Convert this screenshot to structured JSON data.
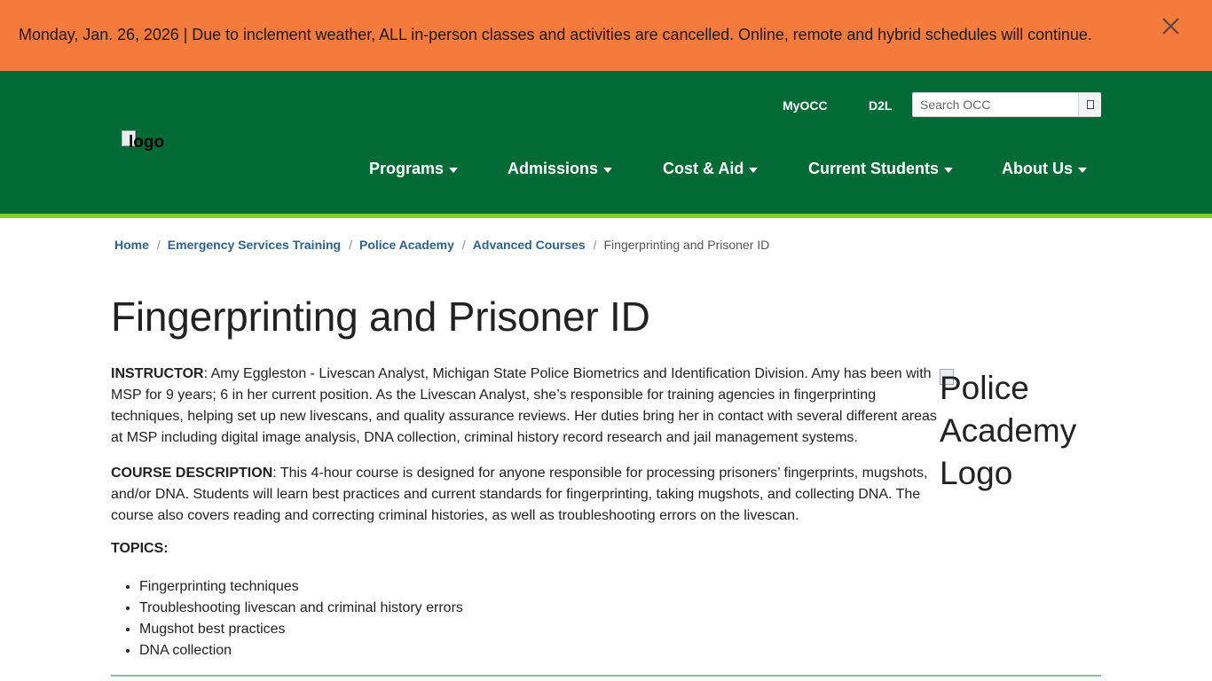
{
  "alert": {
    "message": "Monday, Jan. 26, 2026 | Due to inclement weather, ALL in-person classes and activities are cancelled. Online, remote and hybrid schedules will continue.",
    "close_icon": "close-icon"
  },
  "header": {
    "logo_alt": "logo",
    "utility_links": [
      "MyOCC",
      "D2L"
    ],
    "search": {
      "placeholder": "Search OCC",
      "button_icon": "search-icon"
    },
    "nav": [
      "Programs",
      "Admissions",
      "Cost & Aid",
      "Current Students",
      "About Us"
    ]
  },
  "breadcrumb": {
    "links": [
      "Home",
      "Emergency Services Training",
      "Police Academy",
      "Advanced Courses"
    ],
    "separator": "/",
    "current": "Fingerprinting and Prisoner ID"
  },
  "main": {
    "title": "Fingerprinting and Prisoner ID",
    "instructor_label": "INSTRUCTOR",
    "instructor_text": ": Amy Eggleston - Livescan Analyst, Michigan State Police Biometrics and Identification Division. Amy has been with MSP for 9 years; 6 in her current position.  As the Livescan Analyst, she’s responsible for training agencies in fingerprinting techniques, helping set up new livescans, and quality assurance reviews.  Her duties bring her in contact with several different areas at MSP including digital image analysis, DNA collection, criminal history record research and jail management systems.",
    "description_label": "COURSE DESCRIPTION",
    "description_text": ": This 4-hour course is designed for anyone responsible for processing prisoners’ fingerprints, mugshots, and/or DNA. Students will learn best practices and current standards for fingerprinting, taking mugshots, and collecting DNA. The course also covers reading and correcting criminal histories, as well as troubleshooting errors on the livescan.",
    "topics_label": "TOPICS:",
    "topics": [
      "Fingerprinting techniques",
      "Troubleshooting livescan and criminal history errors",
      "Mugshot best practices",
      "DNA collection"
    ],
    "side_image_alt": "Police Academy Logo"
  },
  "colors": {
    "alert_bg": "#f47b3c",
    "header_bg": "#026b35",
    "accent_bar": "#7ed321",
    "link": "#2a6496"
  }
}
